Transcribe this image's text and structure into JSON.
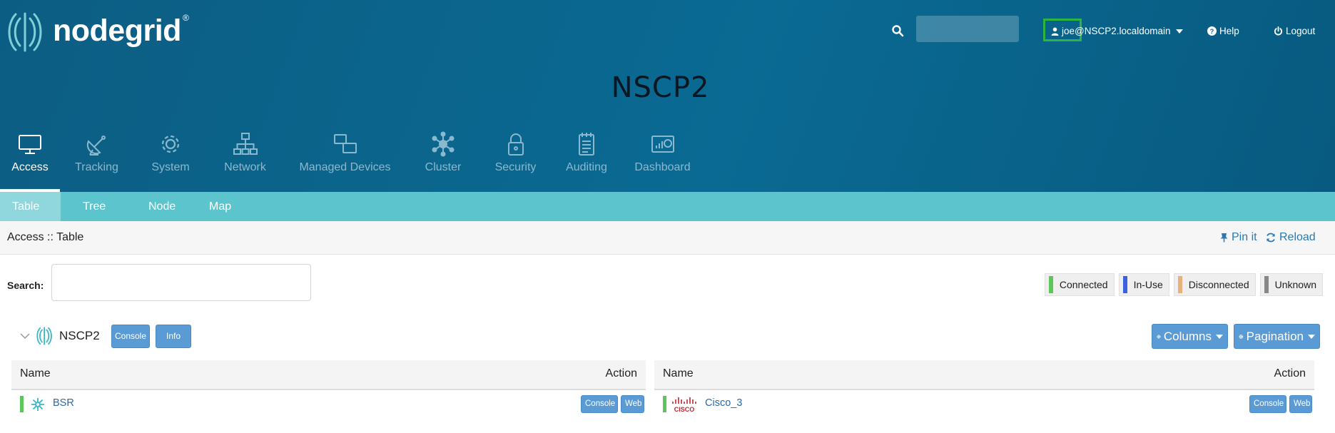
{
  "header": {
    "logo_text": "nodegrid",
    "logo_reg": "®",
    "search_icon": "search-icon",
    "user_label": "joe@NSCP2.localdomain",
    "help_label": "Help",
    "logout_label": "Logout"
  },
  "page_title": "NSCP2",
  "nav": {
    "items": [
      {
        "label": "Access",
        "icon": "monitor-icon"
      },
      {
        "label": "Tracking",
        "icon": "satellite-dish-icon"
      },
      {
        "label": "System",
        "icon": "gear-icon"
      },
      {
        "label": "Network",
        "icon": "network-icon"
      },
      {
        "label": "Managed Devices",
        "icon": "devices-icon"
      },
      {
        "label": "Cluster",
        "icon": "cluster-icon"
      },
      {
        "label": "Security",
        "icon": "lock-icon"
      },
      {
        "label": "Auditing",
        "icon": "notepad-icon"
      },
      {
        "label": "Dashboard",
        "icon": "dashboard-icon"
      }
    ],
    "active": "Access"
  },
  "subnav": {
    "tabs": [
      "Table",
      "Tree",
      "Node",
      "Map"
    ],
    "active": "Table"
  },
  "breadcrumb": "Access :: Table",
  "actions": {
    "pin": "Pin it",
    "reload": "Reload"
  },
  "search": {
    "label": "Search:",
    "value": ""
  },
  "legend": [
    {
      "label": "Connected",
      "color": "#5cc658"
    },
    {
      "label": "In-Use",
      "color": "#3a62e0"
    },
    {
      "label": "Disconnected",
      "color": "#e8b07a"
    },
    {
      "label": "Unknown",
      "color": "#888888"
    }
  ],
  "group": {
    "name": "NSCP2",
    "console_label": "Console",
    "info_label": "Info",
    "columns_label": "Columns",
    "pagination_label": "Pagination"
  },
  "tables": [
    {
      "col_name": "Name",
      "col_action": "Action",
      "rows": [
        {
          "name": "BSR",
          "status": "Connected",
          "console": "Console",
          "web": "Web"
        }
      ]
    },
    {
      "col_name": "Name",
      "col_action": "Action",
      "rows": [
        {
          "name": "Cisco_3",
          "status": "Connected",
          "console": "Console",
          "web": "Web",
          "vendor": "CISCO"
        }
      ]
    }
  ],
  "colors": {
    "header_bg": "#0a6a93",
    "subnav_bg": "#5bc4cc",
    "button_bg": "#5b9bd5",
    "link": "#2a6aa8",
    "user_highlight": "#2db542"
  }
}
